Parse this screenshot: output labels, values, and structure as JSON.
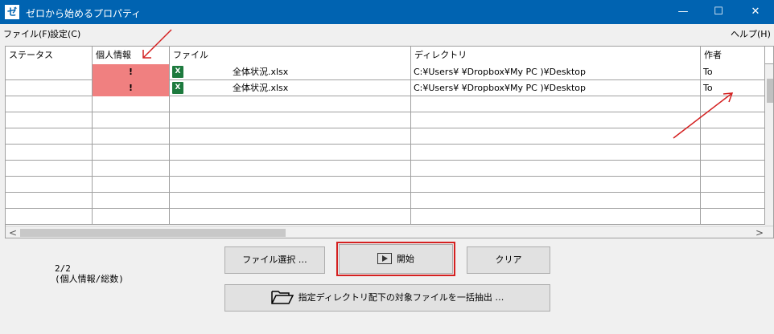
{
  "window": {
    "icon_glyph": "ゼ",
    "title": "ゼロから始めるプロパティ",
    "minimize": "—",
    "maximize": "☐",
    "close": "✕"
  },
  "menu": {
    "file": "ファイル(F)",
    "settings": "設定(C)",
    "help": "ヘルプ(H)"
  },
  "table": {
    "columns": [
      "ステータス",
      "個人情報",
      "ファイル",
      "ディレクトリ",
      "作者"
    ],
    "rows": [
      {
        "status": "",
        "personal": "!",
        "file_icon": "excel-icon",
        "file": "全体状況.xlsx",
        "directory": "C:¥Users¥          ¥Dropbox¥My PC                        )¥Desktop",
        "author": "To"
      },
      {
        "status": "",
        "personal": "!",
        "file_icon": "excel-icon",
        "file": "全体状況.xlsx",
        "directory": "C:¥Users¥          ¥Dropbox¥My PC                        )¥Desktop",
        "author": "To"
      }
    ]
  },
  "scroll": {
    "left": "<",
    "right": ">"
  },
  "summary": {
    "count": "2/2",
    "caption": "(個人情報/総数)"
  },
  "buttons": {
    "file_select": "ファイル選択 …",
    "start": "開始",
    "clear": "クリア",
    "extract": "指定ディレクトリ配下の対象ファイルを一括抽出 …"
  },
  "colors": {
    "titlebar": "#0063b1",
    "flag": "#f08080",
    "highlight": "#d42020"
  }
}
